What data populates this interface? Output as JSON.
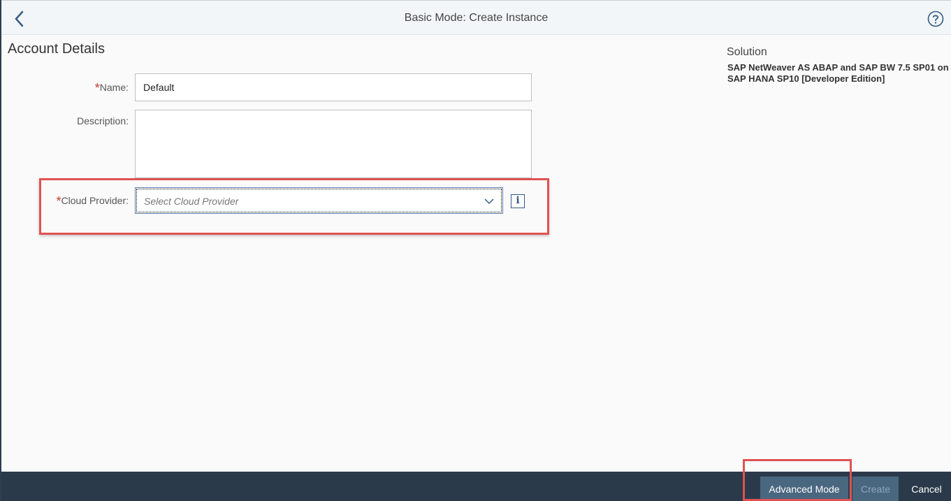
{
  "header": {
    "title": "Basic Mode: Create Instance",
    "back_icon": "chevron-left-icon",
    "help_icon": "question-circle-icon"
  },
  "form": {
    "section_title": "Account Details",
    "name": {
      "label": "Name:",
      "value": "Default"
    },
    "description": {
      "label": "Description:",
      "value": ""
    },
    "cloud_provider": {
      "label": "Cloud Provider:",
      "placeholder": "Select Cloud Provider"
    },
    "required_marker": "*"
  },
  "solution": {
    "label": "Solution",
    "name": "SAP NetWeaver AS ABAP and SAP BW 7.5 SP01 on SAP HANA SP10 [Developer Edition]"
  },
  "footer": {
    "advanced_mode_label": "Advanced Mode",
    "create_label": "Create",
    "cancel_label": "Cancel"
  },
  "colors": {
    "accent": "#345b85",
    "highlight": "#e05252",
    "footer_bg": "#2b3a4a"
  }
}
